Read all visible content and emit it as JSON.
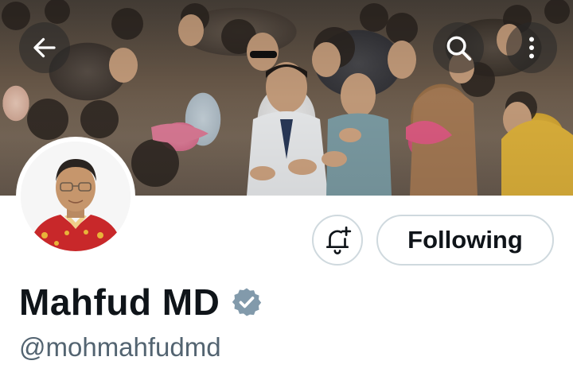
{
  "profile": {
    "display_name": "Mahfud MD",
    "handle": "@mohmahfudmd",
    "verified_icon": "verified-badge-icon",
    "verified_color": "#829aab"
  },
  "actions": {
    "follow_label": "Following",
    "notify_icon": "bell-plus-icon"
  },
  "top_bar": {
    "back_icon": "arrow-left-icon",
    "search_icon": "search-icon",
    "more_icon": "more-vertical-icon"
  },
  "colors": {
    "text_primary": "#0f1419",
    "text_secondary": "#536471",
    "border": "#cfd9de"
  }
}
